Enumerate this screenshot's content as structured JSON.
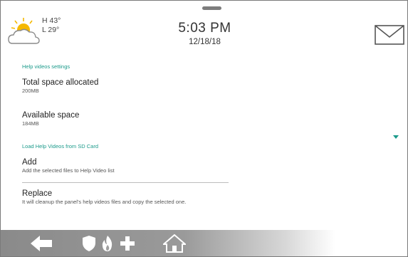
{
  "weather": {
    "high": "H 43°",
    "low": "L 29°",
    "icon": "partly-cloudy-icon"
  },
  "clock": {
    "time": "5:03 PM",
    "date": "12/18/18"
  },
  "header": {
    "mail_icon": "envelope-icon"
  },
  "sections": [
    {
      "header": "Help videos settings"
    },
    {
      "header": "Load Help Videos from SD Card"
    }
  ],
  "items": [
    {
      "title": "Total space allocated",
      "subtitle": "200MB"
    },
    {
      "title": "Available space",
      "subtitle": "184MB"
    },
    {
      "title": "Add",
      "subtitle": "Add the selected files to Help Video list"
    },
    {
      "title": "Replace",
      "subtitle": "It will cleanup the panel's help videos files and copy the selected one."
    }
  ],
  "nav": {
    "back_icon": "back-arrow-icon",
    "security_icon": "shield-icon",
    "fire_icon": "flame-icon",
    "medical_icon": "plus-icon",
    "home_icon": "home-icon"
  },
  "colors": {
    "accent": "#1a9a8a",
    "sun": "#f5b800",
    "bar": "#8a8a8a"
  }
}
